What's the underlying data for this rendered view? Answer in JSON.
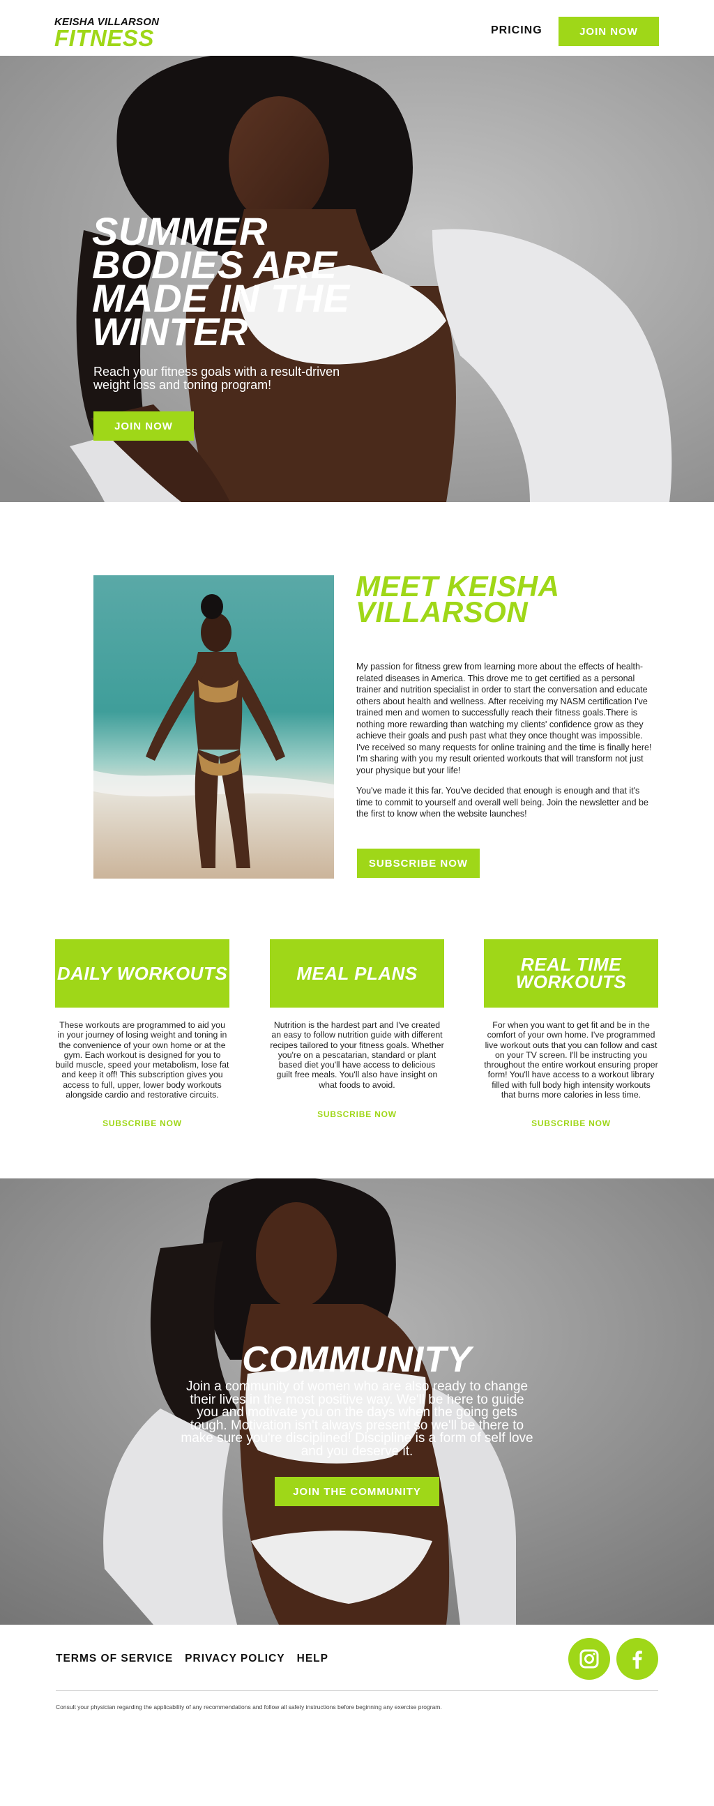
{
  "brand": {
    "top": "KEISHA VILLARSON",
    "bottom": "FITNESS",
    "accent": "#9fd718"
  },
  "nav": {
    "pricing": "PRICING",
    "join": "JOIN NOW"
  },
  "hero": {
    "title": "SUMMER BODIES ARE MADE IN THE WINTER",
    "subtitle": "Reach your fitness goals with a result-driven weight loss and toning program!",
    "cta": "JOIN NOW"
  },
  "about": {
    "heading": "MEET KEISHA VILLARSON",
    "p1": "My passion for fitness grew from learning more about the effects of health-related diseases in America. This drove me to get certified as a personal trainer and nutrition specialist in order to start the conversation and educate others about health and wellness. After receiving my NASM certification I've trained men and women to successfully reach their fitness goals.There is nothing more rewarding than watching my clients' confidence grow as they achieve their goals and push past what they once thought was impossible. I've received so many requests for online training and the time is finally here! I'm sharing with you my result oriented workouts that will transform not just your physique but your life!",
    "p2": "You've made it this far. You've decided that enough is enough and that it's time to commit to yourself and overall well being. Join the newsletter and be the first to know when the website launches!",
    "cta": "SUBSCRIBE NOW"
  },
  "features": [
    {
      "title": "DAILY WORKOUTS",
      "text": "These workouts are programmed to aid you in your journey of losing weight and toning in the convenience of your own home or at the gym. Each workout is designed for you to build muscle, speed your metabolism, lose fat and keep it off! This subscription gives you access to full, upper, lower body workouts alongside cardio and restorative circuits.",
      "link": "SUBSCRIBE NOW"
    },
    {
      "title": "MEAL PLANS",
      "text": "Nutrition is the hardest part and I've created an easy to follow nutrition guide with different recipes tailored to your fitness goals. Whether you're on a pescatarian, standard or plant based diet you'll have access to delicious guilt free meals. You'll also have insight on what foods to avoid.",
      "link": "SUBSCRIBE NOW"
    },
    {
      "title": "REAL TIME WORKOUTS",
      "text": "For when you want to get fit and be in the comfort of your own home. I've programmed live workout outs that you can follow and cast on your TV screen. I'll be instructing you throughout the entire workout ensuring proper form! You'll have access to a workout library filled with full body high intensity workouts that burns more calories in less time.",
      "link": "SUBSCRIBE NOW"
    }
  ],
  "community": {
    "title": "COMMUNITY",
    "text": "Join a community of women who are also ready to change their lives in the most positive way. We'll be here to guide you and motivate you on the days when the going gets tough. Motivation isn't always present so we'll be there to make sure you're disciplined! Discipline is a form of self love and you deserve it.",
    "cta": "JOIN THE COMMUNITY"
  },
  "footer": {
    "links": [
      "TERMS OF SERVICE",
      "PRIVACY POLICY",
      "HELP"
    ],
    "social": [
      "instagram-icon",
      "facebook-icon"
    ],
    "disclaimer": "Consult your physician regarding the applicability of any recommendations and follow all safety instructions before beginning any exercise program."
  }
}
